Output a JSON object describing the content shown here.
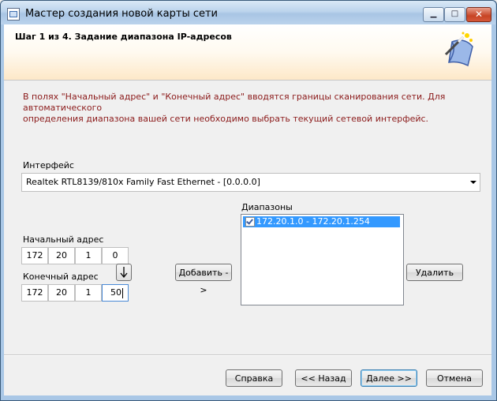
{
  "window": {
    "title": "Мастер создания новой карты сети",
    "min_glyph": "▁",
    "max_glyph": "□",
    "close_glyph": "✕"
  },
  "header": {
    "step_title": "Шаг 1 из 4. Задание диапазона IP-адресов"
  },
  "description": {
    "line1": "В полях \"Начальный адрес\" и \"Конечный адрес\" вводятся границы сканирования сети. Для автоматического",
    "line2": "определения диапазона вашей сети необходимо выбрать текущий сетевой интерфейс."
  },
  "interface": {
    "label": "Интерфейс",
    "value": "Realtek RTL8139/810x Family Fast Ethernet - [0.0.0.0]"
  },
  "start_address": {
    "label": "Начальный адрес",
    "octets": [
      "172",
      "20",
      "1",
      "0"
    ]
  },
  "end_address": {
    "label": "Конечный адрес",
    "octets": [
      "172",
      "20",
      "1",
      "50"
    ]
  },
  "ranges": {
    "label": "Диапазоны",
    "items": [
      {
        "text": "172.20.1.0 - 172.20.1.254",
        "checked": true
      }
    ]
  },
  "buttons": {
    "add": "Добавить ->",
    "delete": "Удалить",
    "help": "Справка",
    "back": "<< Назад",
    "next": "Далее >>",
    "cancel": "Отмена"
  },
  "colors": {
    "description_text": "#8b1a1a",
    "selection": "#3399ff",
    "header_band": "#fde8c8"
  },
  "icons": {
    "wizard": "magic-wand-scroll-icon",
    "copy": "arrow-down-icon"
  }
}
